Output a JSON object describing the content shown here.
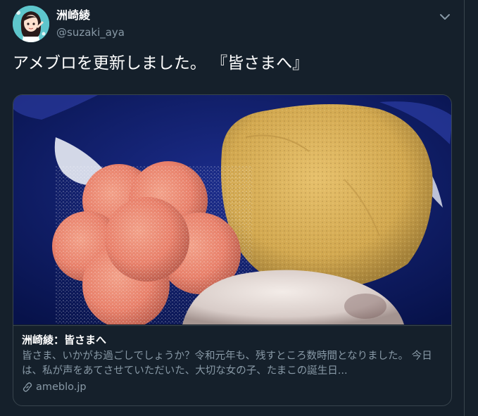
{
  "tweet": {
    "display_name": "洲崎綾",
    "handle": "@suzaki_aya",
    "text": "アメブロを更新しました。 『皆さまへ』"
  },
  "card": {
    "title": "洲崎綾：皆さまへ",
    "description": "皆さま、いかがお過ごしでしょうか？令和元年も、残すところ数時間となりました。 今日は、私が声をあてさせていただいた、大切な女の子、たまこの誕生日...",
    "domain": "ameblo.jp"
  },
  "icons": {
    "menu": "chevron-down-icon",
    "link": "link-icon"
  },
  "colors": {
    "background": "#15202b",
    "border": "#38444d",
    "secondary_text": "#8899a6",
    "accent": "#1da1f2"
  }
}
